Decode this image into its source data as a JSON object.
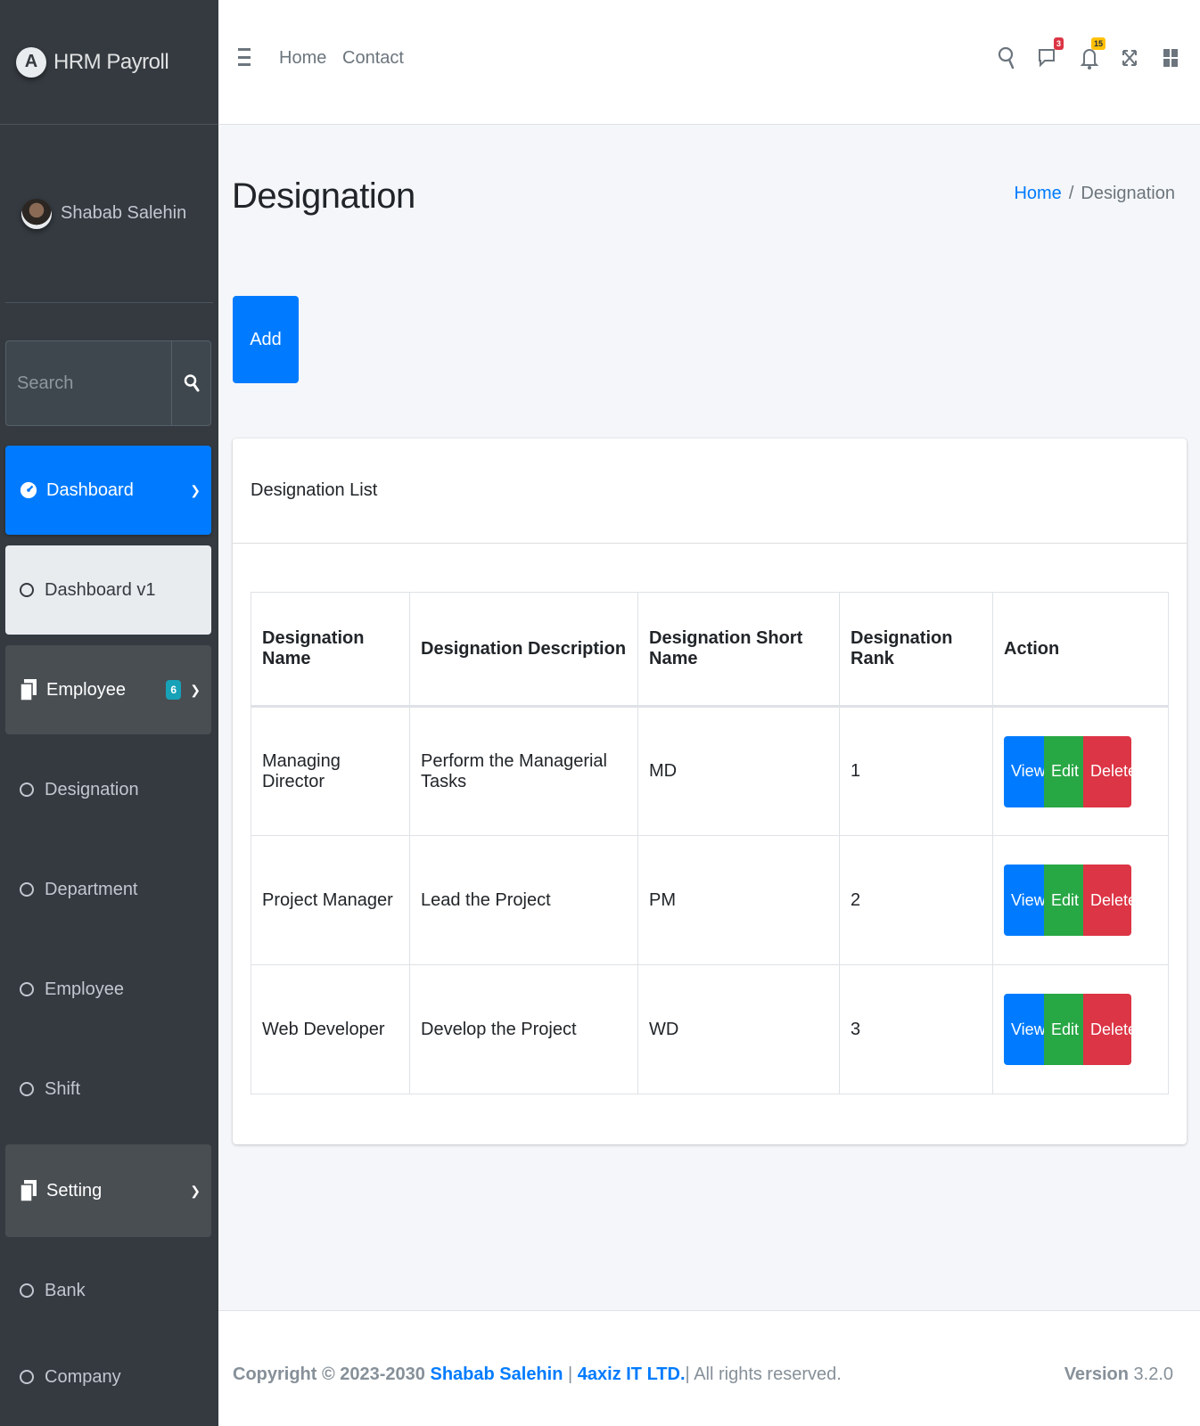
{
  "brand": {
    "logo_letter": "A",
    "name": "HRM Payroll"
  },
  "user": {
    "name": "Shabab Salehin"
  },
  "search": {
    "placeholder": "Search"
  },
  "sidebar": {
    "items": [
      {
        "label": "Dashboard",
        "type": "parent-active"
      },
      {
        "label": "Dashboard v1",
        "type": "sub-active"
      },
      {
        "label": "Employee",
        "type": "parent-open",
        "badge": "6"
      },
      {
        "label": "Designation",
        "type": "sub"
      },
      {
        "label": "Department",
        "type": "sub"
      },
      {
        "label": "Employee",
        "type": "sub"
      },
      {
        "label": "Shift",
        "type": "sub"
      },
      {
        "label": "Setting",
        "type": "parent-open"
      },
      {
        "label": "Bank",
        "type": "sub"
      },
      {
        "label": "Company",
        "type": "sub"
      }
    ]
  },
  "topbar": {
    "links": [
      "Home",
      "Contact"
    ],
    "messages_badge": "3",
    "notifications_badge": "15"
  },
  "page": {
    "title": "Designation",
    "breadcrumb": {
      "home": "Home",
      "current": "Designation",
      "separator": "/"
    },
    "add_label": "Add"
  },
  "card": {
    "title": "Designation List",
    "columns": [
      "Designation Name",
      "Designation Description",
      "Designation Short Name",
      "Designation Rank",
      "Action"
    ],
    "rows": [
      {
        "name": "Managing Director",
        "description": "Perform the Managerial Tasks",
        "short_name": "MD",
        "rank": "1"
      },
      {
        "name": "Project Manager",
        "description": "Lead the Project",
        "short_name": "PM",
        "rank": "2"
      },
      {
        "name": "Web Developer",
        "description": "Develop the Project",
        "short_name": "WD",
        "rank": "3"
      }
    ],
    "actions": {
      "view": "View",
      "edit": "Edit",
      "delete": "Delete"
    }
  },
  "footer": {
    "copyright": "Copyright © 2023-2030",
    "author": "Shabab Salehin",
    "company": "4axiz IT LTD.",
    "rights": "All rights reserved.",
    "version_label": "Version",
    "version": "3.2.0"
  },
  "colors": {
    "primary": "#007bff",
    "success": "#28a745",
    "danger": "#dc3545",
    "sidebar": "#343a40",
    "info": "#17a2b8",
    "warning": "#ffc107"
  }
}
